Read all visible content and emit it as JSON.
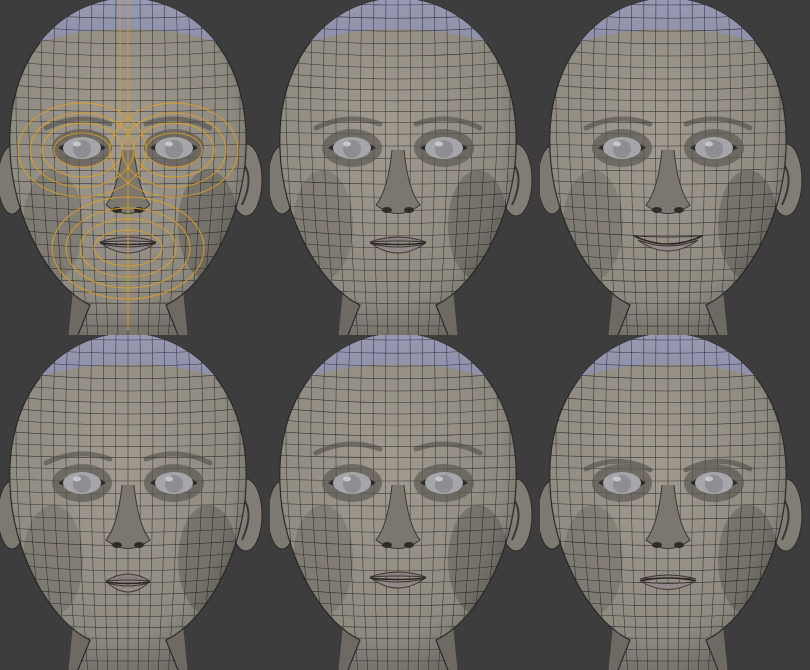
{
  "scene": {
    "background_color": "#3d3d3d",
    "skin_color": "#8f8a80",
    "scalp_color": "#8a8ca6",
    "wire_color": "#1e1e1e",
    "edge_loop_color": "#e0a020"
  },
  "heads": [
    {
      "name": "neutral-edge-loops",
      "expression": "neutral",
      "edge_loops": true
    },
    {
      "name": "neutral",
      "expression": "neutral",
      "edge_loops": false
    },
    {
      "name": "smile",
      "expression": "smile",
      "edge_loops": false
    },
    {
      "name": "pout",
      "expression": "pout",
      "edge_loops": false
    },
    {
      "name": "raised-brows",
      "expression": "surprise",
      "edge_loops": false
    },
    {
      "name": "frown",
      "expression": "frown",
      "edge_loops": false
    }
  ]
}
